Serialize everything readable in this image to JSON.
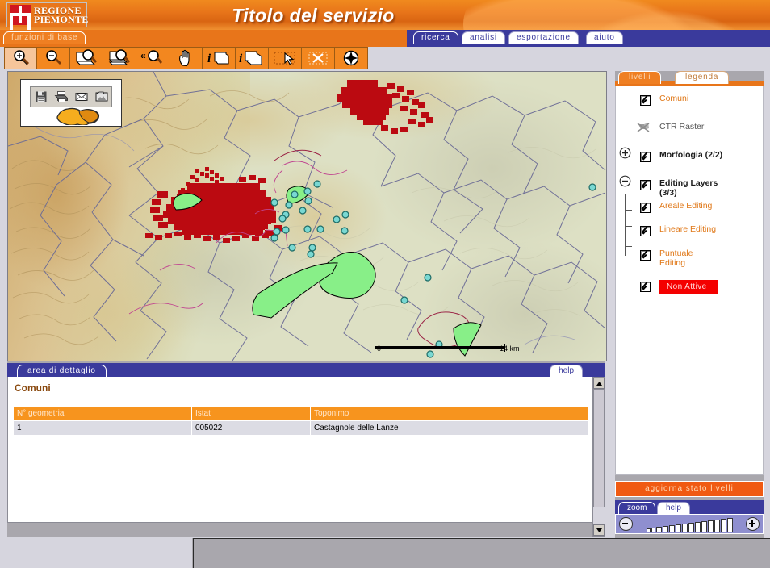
{
  "header": {
    "logo_line1": "REGIONE",
    "logo_line2": "PIEMONTE",
    "title": "Titolo del servizio"
  },
  "tabs": {
    "functions_tab": "funzioni di base",
    "main": [
      {
        "label": "ricerca",
        "active": true
      },
      {
        "label": "analisi",
        "active": false
      },
      {
        "label": "esportazione",
        "active": false
      },
      {
        "label": "aiuto",
        "active": false
      }
    ]
  },
  "toolbar": {
    "buttons": [
      {
        "name": "zoom-in-tool",
        "icon": "magnifier-plus-icon",
        "active": true
      },
      {
        "name": "zoom-out-tool",
        "icon": "magnifier-minus-icon",
        "active": false
      },
      {
        "name": "zoom-to-extent-tool",
        "icon": "magnifier-page-icon",
        "active": false
      },
      {
        "name": "zoom-to-layer-tool",
        "icon": "magnifier-layers-icon",
        "active": false
      },
      {
        "name": "zoom-previous-tool",
        "icon": "magnifier-back-icon",
        "active": false
      },
      {
        "name": "pan-tool",
        "icon": "hand-icon",
        "active": false
      },
      {
        "name": "identify-tool",
        "icon": "info-single-icon",
        "active": false
      },
      {
        "name": "identify-multi-tool",
        "icon": "info-multi-icon",
        "active": false
      },
      {
        "name": "select-box-tool",
        "icon": "select-arrow-box-icon",
        "active": false
      },
      {
        "name": "clear-selection-tool",
        "icon": "box-cross-icon",
        "active": false
      },
      {
        "name": "compass-tool",
        "icon": "compass-icon",
        "active": false
      }
    ]
  },
  "map": {
    "floating_tools": [
      {
        "name": "save-map-button",
        "icon": "floppy-disk-icon"
      },
      {
        "name": "print-map-button",
        "icon": "printer-icon"
      },
      {
        "name": "mail-map-button",
        "icon": "envelope-icon"
      },
      {
        "name": "export-image-button",
        "icon": "image-export-icon"
      }
    ],
    "scale": {
      "start": "0",
      "end": "14 km"
    }
  },
  "detail": {
    "tab_label": "area di dettaglio",
    "help_label": "help",
    "section_title": "Comuni",
    "columns": [
      "N° geometria",
      "Istat",
      "Toponimo"
    ],
    "rows": [
      [
        "1",
        "005022",
        "Castagnole delle Lanze"
      ]
    ]
  },
  "layers_panel": {
    "tabs": [
      {
        "label": "livelli",
        "active": true
      },
      {
        "label": "legenda",
        "active": false
      }
    ],
    "items": [
      {
        "label": "Comuni",
        "checked": true,
        "style": "orange",
        "expander": "none",
        "indent": 0
      },
      {
        "label": "CTR Raster",
        "checked": null,
        "style": "gray",
        "expander": "none",
        "indent": 0,
        "icon": "no-display-icon"
      },
      {
        "label": "Morfologia (2/2)",
        "checked": true,
        "style": "dark",
        "expander": "plus",
        "indent": 0
      },
      {
        "label": "Editing Layers (3/3)",
        "checked": true,
        "style": "dark",
        "expander": "minus",
        "indent": 0
      },
      {
        "label": "Areale Editing",
        "checked": true,
        "style": "child",
        "expander": "none",
        "indent": 1
      },
      {
        "label": "Lineare Editing",
        "checked": true,
        "style": "child",
        "expander": "none",
        "indent": 1
      },
      {
        "label": "Puntuale Editing",
        "checked": true,
        "style": "child",
        "expander": "none",
        "indent": 1
      },
      {
        "label": "Non Attive",
        "checked": true,
        "style": "badge",
        "expander": "none",
        "indent": 0
      }
    ],
    "update_button": "aggiorna stato livelli",
    "zoom_tabs": [
      {
        "label": "zoom",
        "active": true
      },
      {
        "label": "help",
        "active": false
      }
    ],
    "zoom_slider": {
      "steps": 14,
      "value": 14,
      "minus": "−",
      "plus": "+"
    }
  },
  "colors": {
    "brand_orange": "#e8751a",
    "brand_blue": "#3a3a9c",
    "alert_red": "#f40000",
    "table_header": "#f7941e",
    "panel_bg": "#d6d5de"
  }
}
